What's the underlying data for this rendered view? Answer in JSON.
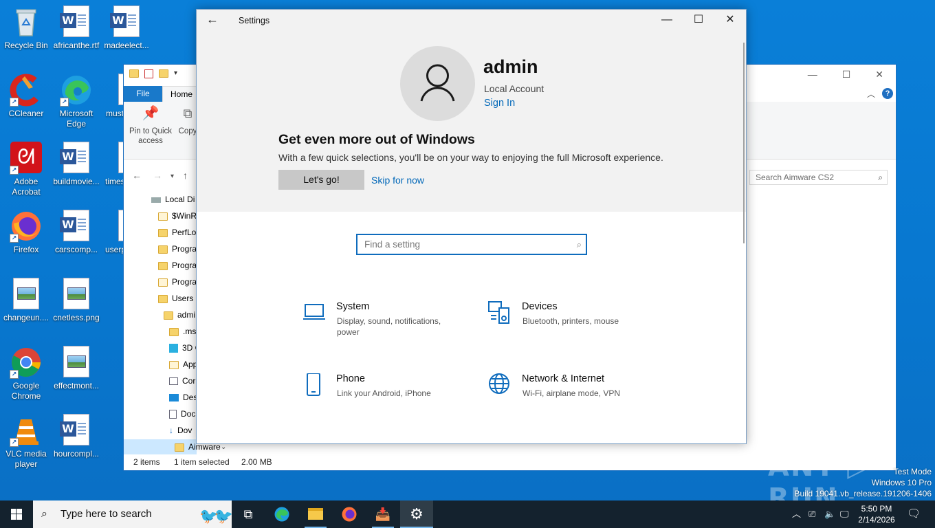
{
  "desktop": {
    "icons": [
      {
        "label": "Recycle Bin"
      },
      {
        "label": "africanthe.rtf"
      },
      {
        "label": "madeelect..."
      },
      {
        "label": "CCleaner"
      },
      {
        "label": "Microsoft Edge"
      },
      {
        "label": "must"
      },
      {
        "label": "Adobe Acrobat"
      },
      {
        "label": "buildmovie..."
      },
      {
        "label": "times"
      },
      {
        "label": "Firefox"
      },
      {
        "label": "carscomp..."
      },
      {
        "label": "userp"
      },
      {
        "label": "changeun...."
      },
      {
        "label": "cnetless.png"
      },
      {
        "label": "Google Chrome"
      },
      {
        "label": "effectmont..."
      },
      {
        "label": "VLC media player"
      },
      {
        "label": "hourcompl..."
      }
    ]
  },
  "explorer": {
    "tab_file": "File",
    "tab_home": "Home",
    "pin_label": "Pin to Quick access",
    "copy_label": "Copy",
    "search_placeholder": "Search Aimware CS2",
    "tree": [
      {
        "label": "Local Di"
      },
      {
        "label": "$WinR"
      },
      {
        "label": "PerfLo"
      },
      {
        "label": "Progra"
      },
      {
        "label": "Progra"
      },
      {
        "label": "Progra"
      },
      {
        "label": "Users"
      },
      {
        "label": "admi"
      },
      {
        "label": ".ms"
      },
      {
        "label": "3D C"
      },
      {
        "label": "App"
      },
      {
        "label": "Cor"
      },
      {
        "label": "Des"
      },
      {
        "label": "Doc"
      },
      {
        "label": "Dov"
      },
      {
        "label": "Aimware"
      }
    ],
    "status_items": "2 items",
    "status_selected": "1 item selected",
    "status_size": "2.00 MB"
  },
  "settings": {
    "window_title": "Settings",
    "account_name": "admin",
    "account_type": "Local Account",
    "sign_in_link": "Sign In",
    "promo_heading": "Get even more out of Windows",
    "promo_text": "With a few quick selections, you'll be on your way to enjoying the full Microsoft experience.",
    "lets_go_button": "Let's go!",
    "skip_link": "Skip for now",
    "search_placeholder": "Find a setting",
    "categories": [
      {
        "title": "System",
        "desc": "Display, sound, notifications, power",
        "icon": "laptop-icon"
      },
      {
        "title": "Devices",
        "desc": "Bluetooth, printers, mouse",
        "icon": "devices-icon"
      },
      {
        "title": "Phone",
        "desc": "Link your Android, iPhone",
        "icon": "phone-icon"
      },
      {
        "title": "Network & Internet",
        "desc": "Wi-Fi, airplane mode, VPN",
        "icon": "globe-icon"
      }
    ],
    "accent_color": "#0067b8"
  },
  "taskbar": {
    "search_text": "Type here to search",
    "time": "5:50 PM",
    "date": "2/14/2026"
  },
  "watermark": {
    "line1": "Test Mode",
    "line2": "Windows 10 Pro",
    "line3": "Build 19041.vb_release.191206-1406",
    "brand": "ANY RUN"
  }
}
